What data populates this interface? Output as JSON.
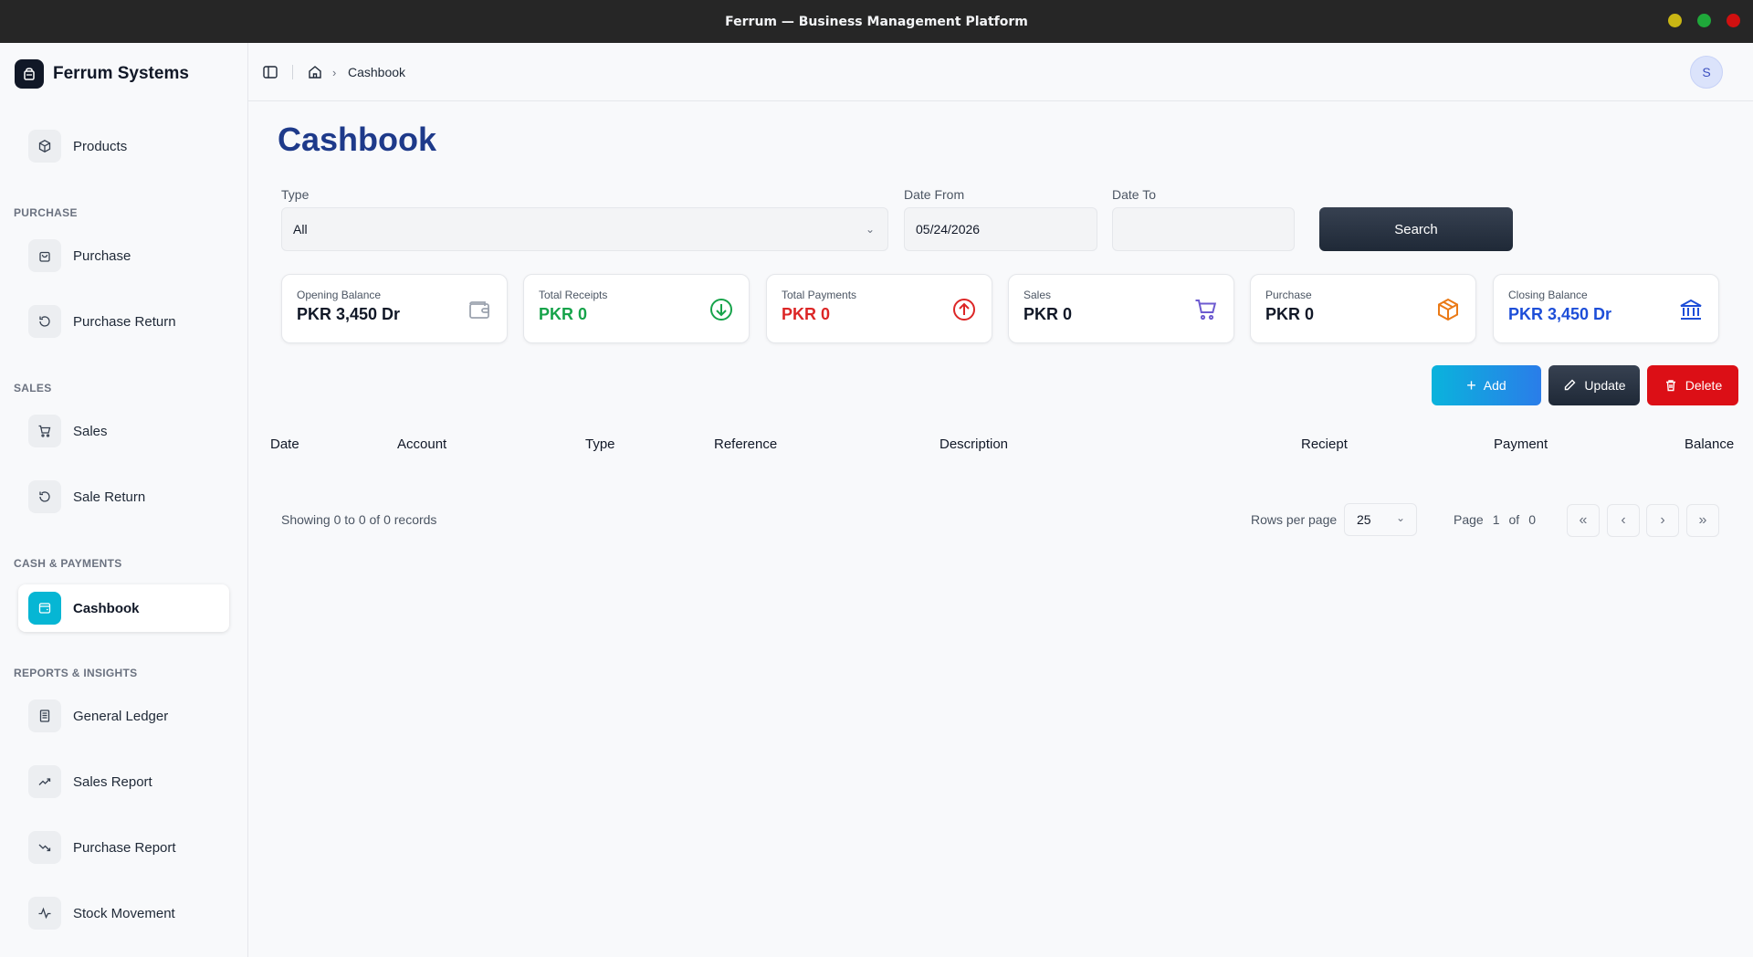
{
  "window": {
    "title": "Ferrum — Business Management Platform",
    "controls": {
      "minimize_color": "#c9b614",
      "maximize_color": "#1fa83a",
      "close_color": "#d01010"
    }
  },
  "sidebar": {
    "brand": "Ferrum Systems",
    "sections": {
      "purchase": "PURCHASE",
      "sales": "SALES",
      "cash": "CASH & PAYMENTS",
      "reports": "REPORTS & INSIGHTS"
    },
    "items": {
      "products": {
        "label": "Products",
        "icon": "box-icon"
      },
      "purchase": {
        "label": "Purchase",
        "icon": "bag-icon"
      },
      "purchase_return": {
        "label": "Purchase Return",
        "icon": "undo-icon"
      },
      "sales": {
        "label": "Sales",
        "icon": "cart-icon"
      },
      "sale_return": {
        "label": "Sale Return",
        "icon": "undo-icon"
      },
      "cashbook": {
        "label": "Cashbook",
        "icon": "wallet-icon",
        "active": true
      },
      "general_ledger": {
        "label": "General Ledger",
        "icon": "ledger-icon"
      },
      "sales_report": {
        "label": "Sales Report",
        "icon": "trending-up-icon"
      },
      "purchase_report": {
        "label": "Purchase Report",
        "icon": "trending-down-icon"
      },
      "stock_movement": {
        "label": "Stock Movement",
        "icon": "activity-icon"
      }
    }
  },
  "header": {
    "breadcrumb": "Cashbook",
    "avatar_initial": "S"
  },
  "main": {
    "title": "Cashbook",
    "filters": {
      "type_label": "Type",
      "type_value": "All",
      "date_from_label": "Date From",
      "date_from_value": "05/24/2026",
      "date_to_label": "Date To",
      "date_to_value": "",
      "search_label": "Search"
    },
    "cards": {
      "opening": {
        "label": "Opening Balance",
        "value": "PKR 3,450 Dr",
        "color": "#111827",
        "icon": "wallet-icon"
      },
      "receipts": {
        "label": "Total Receipts",
        "value": "PKR 0",
        "color": "#16a34a",
        "icon": "arrow-down-circle-icon"
      },
      "payments": {
        "label": "Total Payments",
        "value": "PKR 0",
        "color": "#dc2626",
        "icon": "arrow-up-circle-icon"
      },
      "sales": {
        "label": "Sales",
        "value": "PKR 0",
        "color": "#111827",
        "icon": "cart-icon"
      },
      "purchase": {
        "label": "Purchase",
        "value": "PKR 0",
        "color": "#111827",
        "icon": "package-icon"
      },
      "closing": {
        "label": "Closing Balance",
        "value": "PKR 3,450 Dr",
        "color": "#1d4ed8",
        "icon": "bank-icon"
      }
    },
    "actions": {
      "add": "Add",
      "update": "Update",
      "delete": "Delete"
    },
    "table": {
      "columns": {
        "date": "Date",
        "account": "Account",
        "type": "Type",
        "reference": "Reference",
        "description": "Description",
        "receipt": "Reciept",
        "payment": "Payment",
        "balance": "Balance"
      },
      "rows": []
    },
    "footer": {
      "showing": "Showing 0 to 0 of 0 records",
      "rows_per_page_label": "Rows per page",
      "rows_per_page_value": "25",
      "page_word": "Page",
      "page_current": "1",
      "of_word": "of",
      "page_total": "0"
    }
  }
}
